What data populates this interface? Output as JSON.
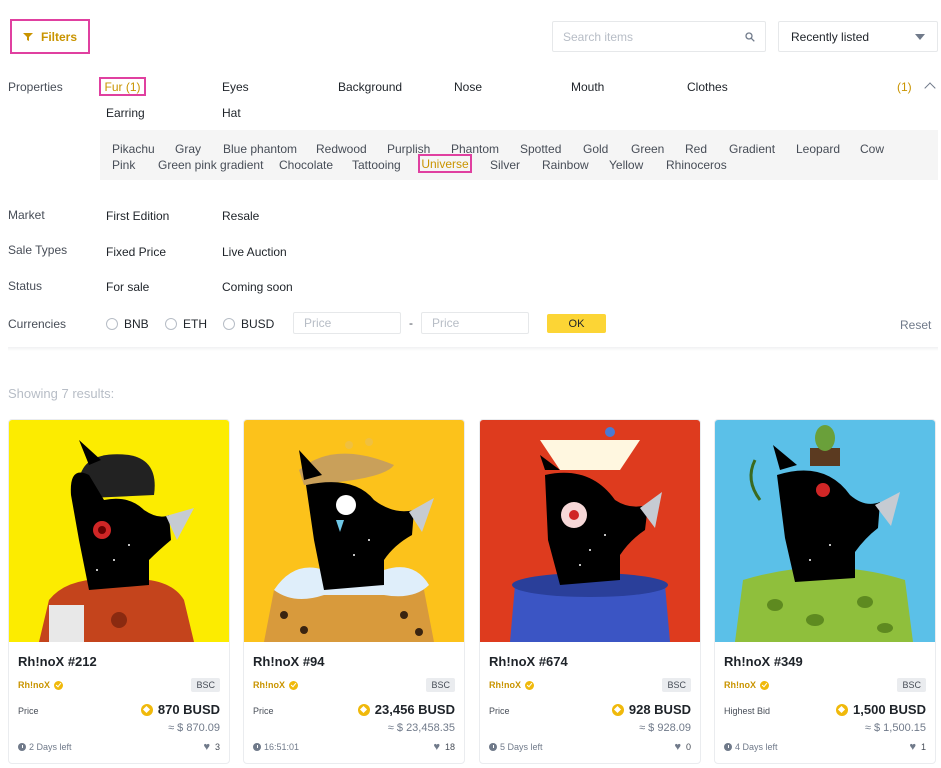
{
  "toolbar": {
    "filters_label": "Filters",
    "search_placeholder": "Search items",
    "sort_value": "Recently listed"
  },
  "filters": {
    "properties_label": "Properties",
    "properties": [
      "Fur (1)",
      "Eyes",
      "Background",
      "Nose",
      "Mouth",
      "Clothes",
      "Earring",
      "Hat"
    ],
    "properties_count": "(1)",
    "fur_values_row1": [
      "Pikachu",
      "Gray",
      "Blue phantom",
      "Redwood",
      "Purplish",
      "Phantom",
      "Spotted",
      "Gold",
      "Green",
      "Red",
      "Gradient",
      "Leopard",
      "Cow"
    ],
    "fur_values_row2": [
      "Pink",
      "Green pink gradient",
      "Chocolate",
      "Tattooing",
      "Universe",
      "Silver",
      "Rainbow",
      "Yellow",
      "Rhinoceros"
    ],
    "market_label": "Market",
    "market": [
      "First Edition",
      "Resale"
    ],
    "sale_types_label": "Sale Types",
    "sale_types": [
      "Fixed Price",
      "Live Auction"
    ],
    "status_label": "Status",
    "status": [
      "For sale",
      "Coming soon"
    ],
    "currencies_label": "Currencies",
    "currencies": [
      "BNB",
      "ETH",
      "BUSD"
    ],
    "price_min_placeholder": "Price",
    "price_dash": "-",
    "price_max_placeholder": "Price",
    "ok_label": "OK",
    "reset_label": "Reset"
  },
  "results": {
    "showing": "Showing 7 results:"
  },
  "cards": [
    {
      "name": "Rh!noX #212",
      "creator": "Rh!noX",
      "chain": "BSC",
      "price_label": "Price",
      "price": "870 BUSD",
      "usd": "≈ $ 870.09",
      "time": "2 Days left",
      "likes": "3",
      "bg": "#fcec00"
    },
    {
      "name": "Rh!noX #94",
      "creator": "Rh!noX",
      "chain": "BSC",
      "price_label": "Price",
      "price": "23,456 BUSD",
      "usd": "≈ $ 23,458.35",
      "time": "16:51:01",
      "likes": "18",
      "bg": "#fcc21b"
    },
    {
      "name": "Rh!noX #674",
      "creator": "Rh!noX",
      "chain": "BSC",
      "price_label": "Price",
      "price": "928 BUSD",
      "usd": "≈ $ 928.09",
      "time": "5 Days left",
      "likes": "0",
      "bg": "#de3b1e"
    },
    {
      "name": "Rh!noX #349",
      "creator": "Rh!noX",
      "chain": "BSC",
      "price_label": "Highest Bid",
      "price": "1,500 BUSD",
      "usd": "≈ $ 1,500.15",
      "time": "4 Days left",
      "likes": "1",
      "bg": "#5bc0e8"
    }
  ]
}
